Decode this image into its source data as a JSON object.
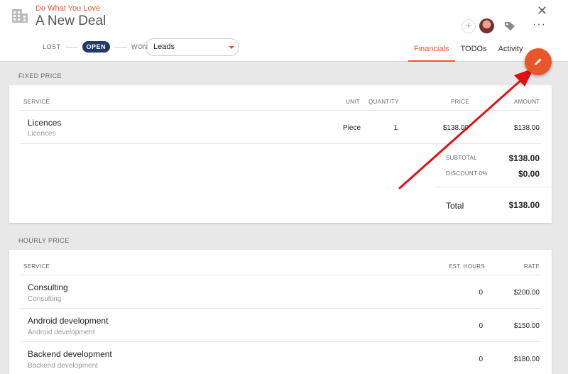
{
  "header": {
    "company": "Do What You Love",
    "title": "A New Deal",
    "status": {
      "lost": "LOST",
      "open": "OPEN",
      "won": "WON"
    },
    "pipeline": "Leads",
    "add_symbol": "+",
    "more_symbol": "···",
    "close_symbol": "✕",
    "tabs": [
      {
        "label": "Financials",
        "active": true
      },
      {
        "label": "TODOs",
        "active": false
      },
      {
        "label": "Activity",
        "active": false
      }
    ]
  },
  "fixed": {
    "title": "FIXED PRICE",
    "columns": {
      "service": "SERVICE",
      "unit": "UNIT",
      "quantity": "QUANTITY",
      "price": "PRICE",
      "amount": "AMOUNT"
    },
    "rows": [
      {
        "name": "Licences",
        "sub": "Licences",
        "unit": "Piece",
        "quantity": "1",
        "price": "$138.00",
        "amount": "$138.00"
      }
    ],
    "subtotal_label": "SUBTOTAL",
    "subtotal": "$138.00",
    "discount_label": "DISCOUNT 0%",
    "discount": "$0.00",
    "total_label": "Total",
    "total": "$138.00"
  },
  "hourly": {
    "title": "HOURLY PRICE",
    "columns": {
      "service": "SERVICE",
      "hours": "EST. HOURS",
      "rate": "RATE"
    },
    "rows": [
      {
        "name": "Consulting",
        "sub": "Consulting",
        "hours": "0",
        "rate": "$200.00"
      },
      {
        "name": "Android development",
        "sub": "Android development",
        "hours": "0",
        "rate": "$150.00"
      },
      {
        "name": "Backend development",
        "sub": "Backend development",
        "hours": "0",
        "rate": "$180.00"
      }
    ]
  },
  "colors": {
    "accent": "#e8572a",
    "status_open": "#1e3a66",
    "annotation_arrow": "#e01010"
  },
  "icons": {
    "logo": "building-icon",
    "tag": "tag-icon",
    "edit": "pencil-icon"
  }
}
